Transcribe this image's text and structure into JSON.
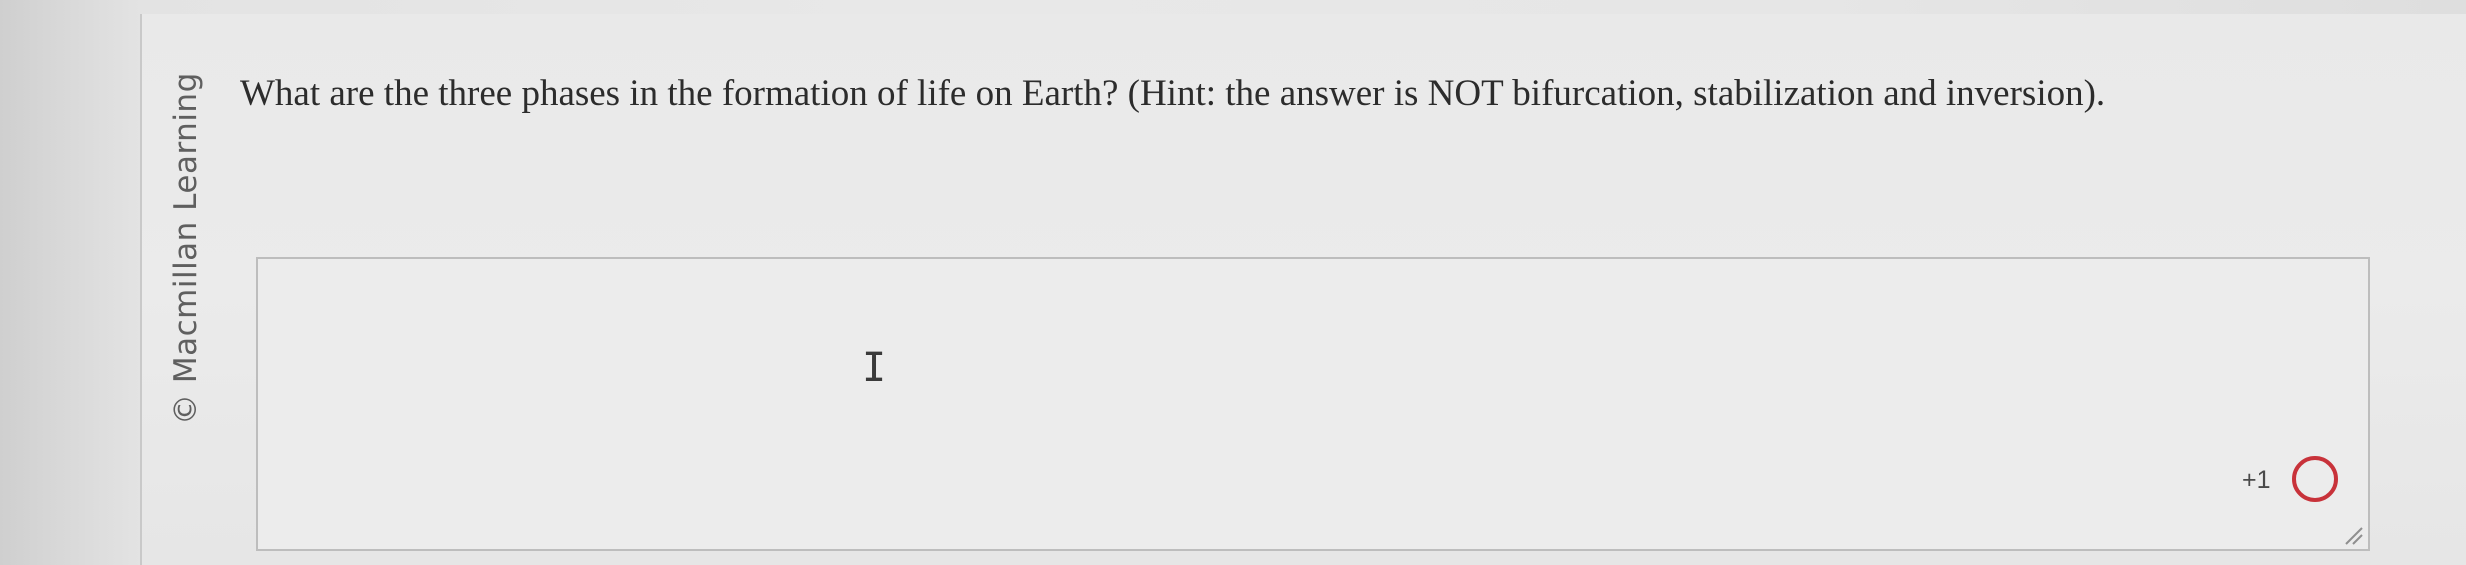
{
  "watermark": {
    "text": "© Macmillan Learning"
  },
  "question": {
    "text": "What are the three phases in the formation of life on Earth? (Hint: the answer is NOT bifurcation, stabilization and inversion)."
  },
  "answer": {
    "value": "",
    "cursor_glyph": "I"
  },
  "scoring": {
    "points_label": "+1",
    "status_color": "#c8323a"
  }
}
